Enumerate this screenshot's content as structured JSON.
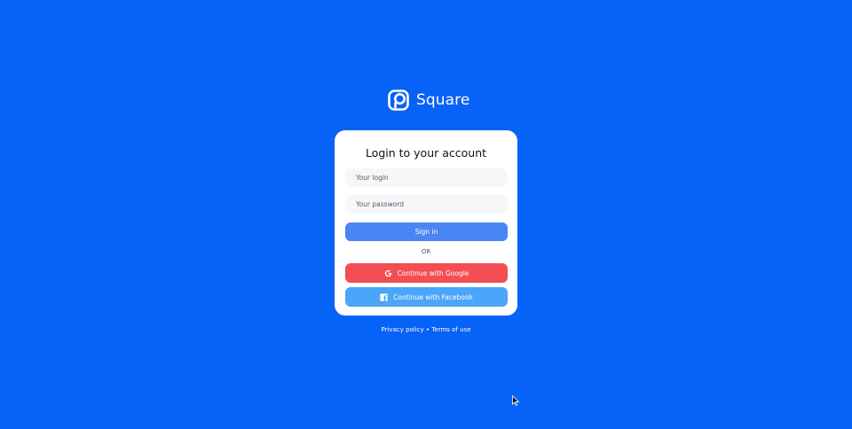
{
  "brand": {
    "name": "Square",
    "logo_icon": "square-logo-icon"
  },
  "login_card": {
    "title": "Login to your account",
    "login_placeholder": "Your login",
    "password_placeholder": "Your password",
    "signin_label": "Sign in",
    "divider_label": "OR",
    "google_label": "Continue with Google",
    "google_icon": "google-icon",
    "facebook_label": "Continue with Facebook",
    "facebook_icon": "facebook-icon"
  },
  "footer": {
    "privacy_label": "Privacy policy",
    "separator": "•",
    "terms_label": "Terms of use"
  },
  "colors": {
    "background": "#0762F7",
    "signin_button": "#4A86F3",
    "google_button": "#F34E53",
    "facebook_button": "#4AA6F8",
    "input_background": "#F6F7F9"
  }
}
